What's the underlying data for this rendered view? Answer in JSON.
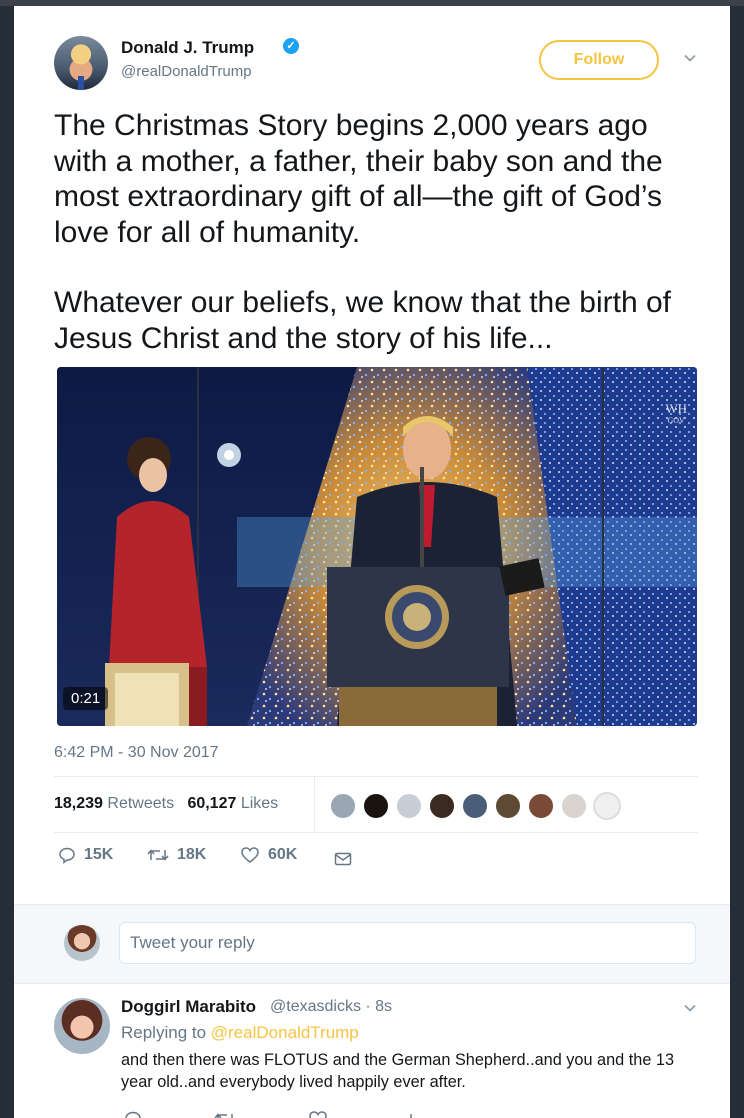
{
  "tweet": {
    "author_name": "Donald J. Trump",
    "handle": "@realDonaldTrump",
    "follow_label": "Follow",
    "paragraph_1": "The Christmas Story begins 2,000 years ago with a mother, a father, their baby son and the most extraordinary gift of all—the gift of God’s love for all of humanity.",
    "paragraph_2": "Whatever our beliefs, we know that the birth of Jesus Christ and the story of his life...",
    "video_duration": "0:21",
    "video_watermark": "WH",
    "video_watermark_sub": "GOV",
    "timestamp": "6:42 PM - 30 Nov 2017",
    "retweets_count": "18,239",
    "retweets_label": "Retweets",
    "likes_count": "60,127",
    "likes_label": "Likes",
    "actions": {
      "replies": "15K",
      "retweets": "18K",
      "likes": "60K"
    }
  },
  "reply_box": {
    "placeholder": "Tweet your reply"
  },
  "reply": {
    "name": "Doggirl Marabito",
    "handle": "@texasdicks · 8s",
    "replying_prefix": "Replying to",
    "replying_to": "@realDonaldTrump",
    "text": "and then there was FLOTUS and the German Shepherd..and you and the 13 year old..and everybody lived happily ever after."
  },
  "colors": {
    "accent": "#f5c542",
    "verified": "#1da1f2",
    "muted": "#657786",
    "background": "#242d38"
  }
}
